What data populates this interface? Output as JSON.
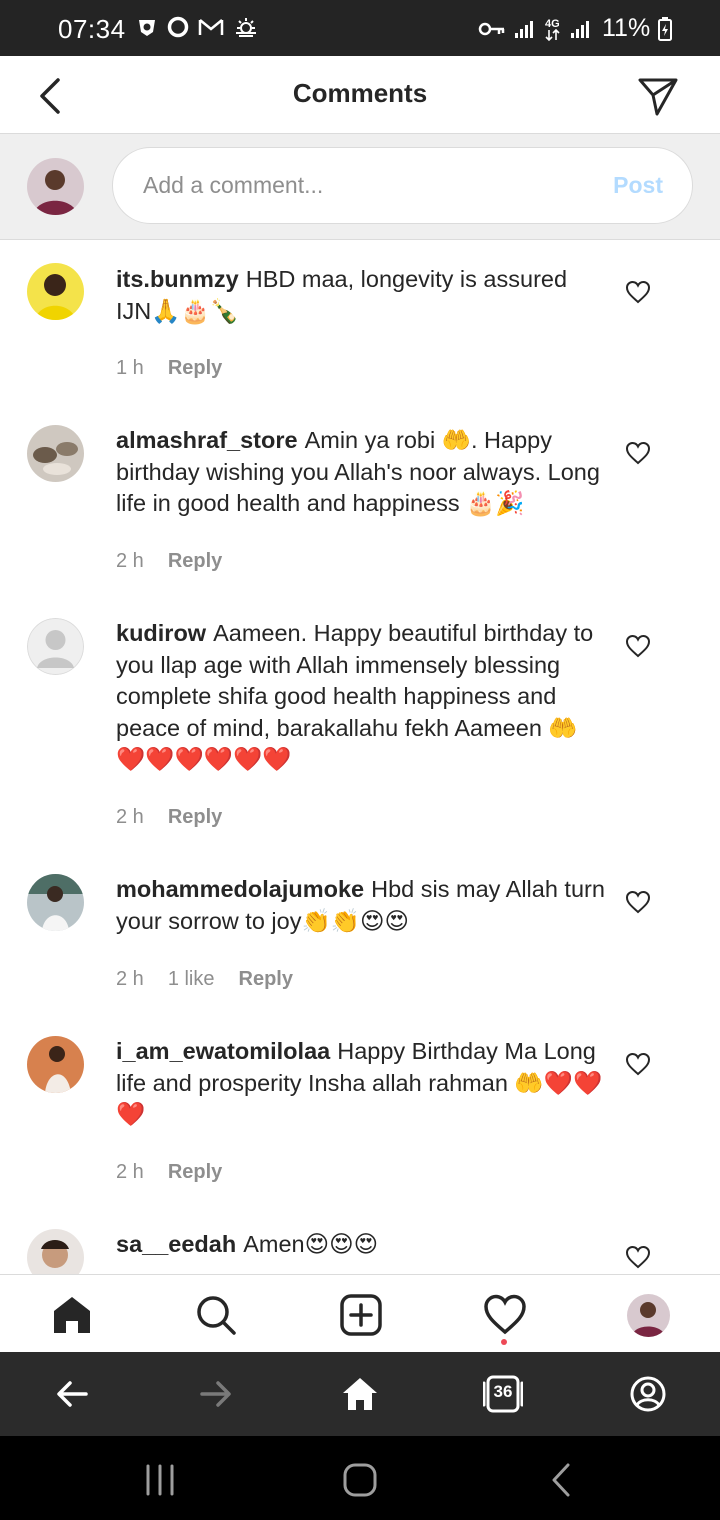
{
  "status_bar": {
    "time": "07:34",
    "network": "4G",
    "battery": "11%"
  },
  "header": {
    "title": "Comments"
  },
  "composer": {
    "placeholder": "Add a comment...",
    "post_label": "Post"
  },
  "comments": [
    {
      "username": "its.bunmzy",
      "text": "HBD maa, longevity is assured IJN🙏🎂🍾",
      "time": "1 h",
      "likes": "",
      "reply": "Reply"
    },
    {
      "username": "almashraf_store",
      "text": "Amin ya robi 🤲. Happy birthday wishing you Allah's noor always. Long life in good health and happiness 🎂🎉",
      "time": "2 h",
      "likes": "",
      "reply": "Reply"
    },
    {
      "username": "kudirow",
      "text": "Aameen. Happy beautiful birthday to you llap age with Allah immensely blessing complete shifa good health happiness and peace of mind, barakallahu fekh Aameen 🤲❤️❤️❤️❤️❤️❤️",
      "time": "2 h",
      "likes": "",
      "reply": "Reply"
    },
    {
      "username": "mohammedolajumoke",
      "text": "Hbd sis may Allah turn your sorrow to joy👏👏😍😍",
      "time": "2 h",
      "likes": "1 like",
      "reply": "Reply"
    },
    {
      "username": "i_am_ewatomilolaa",
      "text": "Happy Birthday Ma Long life and prosperity Insha allah rahman 🤲❤️❤️❤️",
      "time": "2 h",
      "likes": "",
      "reply": "Reply"
    },
    {
      "username": "sa__eedah",
      "text": "Amen😍😍😍",
      "time": "",
      "likes": "",
      "reply": ""
    }
  ],
  "browser_bar": {
    "tab_count": "36"
  },
  "colors": {
    "status_bar_bg": "#242424",
    "post_disabled": "#b3dbff",
    "activity_dot": "#ed4956"
  }
}
